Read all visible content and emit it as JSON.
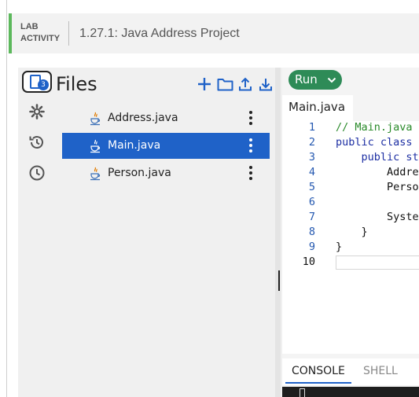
{
  "lab": {
    "tag_line1": "LAB",
    "tag_line2": "ACTIVITY",
    "title": "1.27.1: Java Address Project",
    "accent_color": "#5cb85c"
  },
  "files_panel": {
    "title": "Files",
    "logo_badge": "3",
    "toolbar_icons": [
      "add-file-icon",
      "add-folder-icon",
      "upload-icon",
      "download-icon"
    ],
    "side_icons": [
      "settings-icon",
      "history-icon",
      "clock-icon"
    ],
    "files": [
      {
        "name": "Address.java",
        "active": false
      },
      {
        "name": "Main.java",
        "active": true
      },
      {
        "name": "Person.java",
        "active": false
      }
    ]
  },
  "editor": {
    "run_label": "Run",
    "open_tab": "Main.java",
    "lines": [
      {
        "num": "1",
        "parts": [
          {
            "t": "// Main.java",
            "c": "comment"
          }
        ]
      },
      {
        "num": "2",
        "parts": [
          {
            "t": "public class",
            "c": "keyword"
          }
        ]
      },
      {
        "num": "3",
        "parts": [
          {
            "t": "    ",
            "c": ""
          },
          {
            "t": "public st",
            "c": "keyword"
          }
        ]
      },
      {
        "num": "4",
        "parts": [
          {
            "t": "        Addre",
            "c": ""
          }
        ]
      },
      {
        "num": "5",
        "parts": [
          {
            "t": "        Perso",
            "c": ""
          }
        ]
      },
      {
        "num": "6",
        "parts": []
      },
      {
        "num": "7",
        "parts": [
          {
            "t": "        Syste",
            "c": ""
          }
        ]
      },
      {
        "num": "8",
        "parts": [
          {
            "t": "    }",
            "c": ""
          }
        ]
      },
      {
        "num": "9",
        "parts": [
          {
            "t": "}",
            "c": ""
          }
        ]
      },
      {
        "num": "10",
        "parts": [],
        "current": true
      }
    ]
  },
  "console": {
    "tabs": [
      {
        "label": "CONSOLE",
        "active": true
      },
      {
        "label": "SHELL",
        "active": false
      }
    ]
  },
  "colors": {
    "primary": "#1f62c8",
    "run_green": "#2e8b57",
    "comment_green": "#2a8a2a",
    "keyword_blue": "#1d2fa3"
  }
}
